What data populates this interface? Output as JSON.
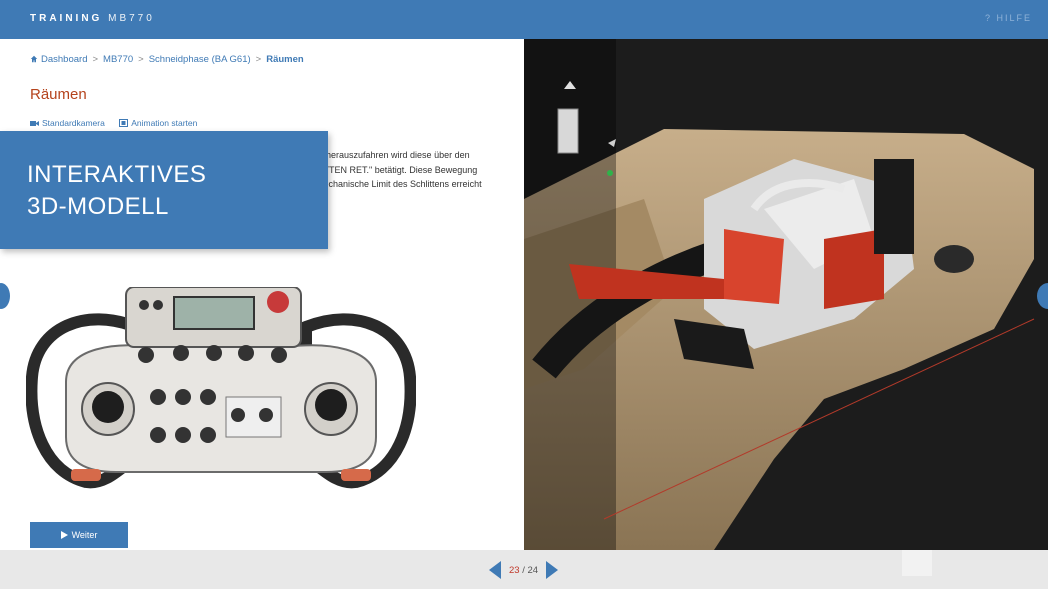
{
  "header": {
    "brand_bold": "TRAINING",
    "brand_model": "MB770",
    "help_label": "? HILFE"
  },
  "breadcrumb": {
    "items": [
      "Dashboard",
      "MB770",
      "Schneidphase (BA G61)"
    ],
    "current": "Räumen"
  },
  "page": {
    "title": "Räumen",
    "camera_label": "Standardkamera",
    "animation_label": "Animation starten",
    "body_lines": [
      "ut herauszufahren wird diese über den",
      "LITTEN RET.\" betätigt. Diese Bewegung",
      "mechanische Limit des Schlittens erreicht"
    ]
  },
  "overlay": {
    "line1": "INTERAKTIVES",
    "line2": "3D-MODELL"
  },
  "actions": {
    "weiter_label": "Weiter"
  },
  "pager": {
    "current": "23",
    "separator": " / ",
    "total": "24"
  },
  "colors": {
    "primary": "#3f7ab5",
    "title": "#b5431c",
    "viewer_bg": "#1c1c1c",
    "footer_bg": "#e8e8e8"
  }
}
